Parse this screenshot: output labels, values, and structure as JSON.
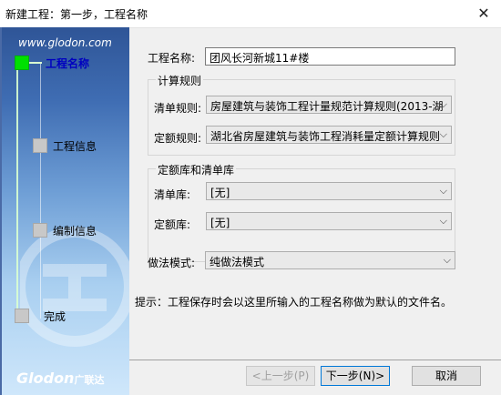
{
  "window": {
    "title": "新建工程：第一步，工程名称",
    "close_glyph": "✕"
  },
  "sidebar": {
    "url": "www.glodon.com",
    "steps": [
      {
        "label": "工程名称",
        "active": true
      },
      {
        "label": "工程信息",
        "active": false
      },
      {
        "label": "编制信息",
        "active": false
      },
      {
        "label": "完成",
        "active": false
      }
    ],
    "logo": {
      "text": "Glodon",
      "sub": "广联达"
    }
  },
  "form": {
    "project_name_label": "工程名称:",
    "project_name_value": "团风长河新城11#楼",
    "calc_rules": {
      "title": "计算规则",
      "bill_rule_label": "清单规则:",
      "bill_rule_value": "房屋建筑与装饰工程计量规范计算规则(2013-湖",
      "quota_rule_label": "定额规则:",
      "quota_rule_value": "湖北省房屋建筑与装饰工程消耗量定额计算规则"
    },
    "libraries": {
      "title": "定额库和清单库",
      "bill_lib_label": "清单库:",
      "bill_lib_value": "[无]",
      "quota_lib_label": "定额库:",
      "quota_lib_value": "[无]"
    },
    "method_label": "做法模式:",
    "method_value": "纯做法模式",
    "hint": "提示：工程保存时会以这里所输入的工程名称做为默认的文件名。"
  },
  "buttons": {
    "prev": "<上一步(P)",
    "next": "下一步(N)>",
    "cancel": "取消"
  },
  "icons": {
    "dropdown": "chevron-down-icon"
  }
}
